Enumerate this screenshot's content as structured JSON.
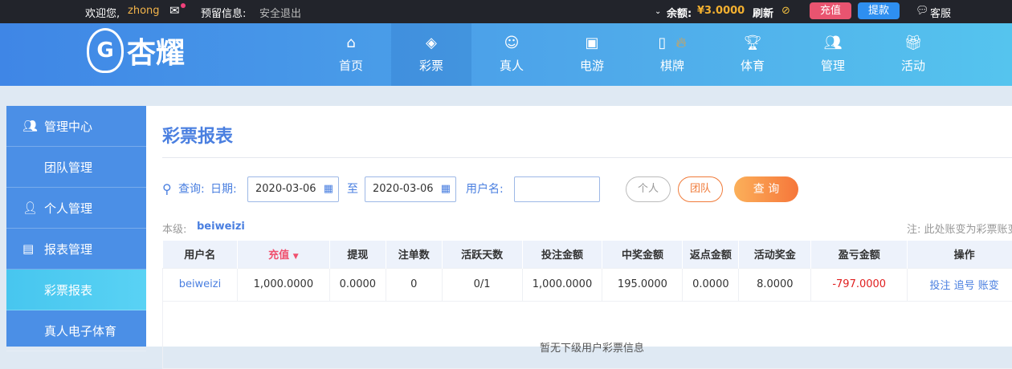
{
  "topbar": {
    "welcome": "欢迎您,",
    "username": "zhong",
    "reserve_info": "预留信息:",
    "logout": "安全退出",
    "balance_label": "余额:",
    "balance": "¥3.0000",
    "refresh": "刷新",
    "recharge": "充值",
    "withdraw": "提款",
    "service": "客服"
  },
  "logo": {
    "text": "杏耀"
  },
  "nav": [
    {
      "label": "首页",
      "icon": "home-icon"
    },
    {
      "label": "彩票",
      "icon": "lottery-ticket-icon"
    },
    {
      "label": "真人",
      "icon": "live-dealer-icon"
    },
    {
      "label": "电游",
      "icon": "slot-machine-icon"
    },
    {
      "label": "棋牌",
      "icon": "card-icon"
    },
    {
      "label": "体育",
      "icon": "trophy-icon"
    },
    {
      "label": "管理",
      "icon": "users-icon"
    },
    {
      "label": "活动",
      "icon": "gift-icon"
    }
  ],
  "nav_active": "彩票",
  "sidebar": [
    {
      "label": "管理中心"
    },
    {
      "label": "团队管理"
    },
    {
      "label": "个人管理"
    },
    {
      "label": "报表管理"
    },
    {
      "label": "彩票报表"
    },
    {
      "label": "真人电子体育"
    }
  ],
  "page": {
    "title": "彩票报表",
    "query_label": "查询:",
    "date_label": "日期:",
    "date_from": "2020-03-06",
    "to": "至",
    "date_to": "2020-03-06",
    "username_label": "用户名:",
    "username_value": "",
    "personal": "个人",
    "team": "团队",
    "search": "查 询",
    "level_label": "本级:",
    "level_user": "beiweizi",
    "note": "注: 此处账变为彩票账变"
  },
  "table": {
    "headers": [
      "用户名",
      "充值",
      "提现",
      "注单数",
      "活跃天数",
      "投注金额",
      "中奖金额",
      "返点金额",
      "活动奖金",
      "盈亏金额",
      "操作"
    ],
    "rows": [
      {
        "user": "beiweizi",
        "recharge": "1,000.0000",
        "withdraw": "0.0000",
        "orders": "0",
        "active_days": "0/1",
        "bet": "1,000.0000",
        "win": "195.0000",
        "rebate": "0.0000",
        "bonus": "8.0000",
        "profit": "-797.0000",
        "actions": [
          "投注",
          "追号",
          "账变"
        ]
      }
    ],
    "empty": "暂无下级用户彩票信息"
  },
  "colors": {
    "accent": "#4a7fe0",
    "loss": "#e02020",
    "sort": "#f0506e"
  }
}
